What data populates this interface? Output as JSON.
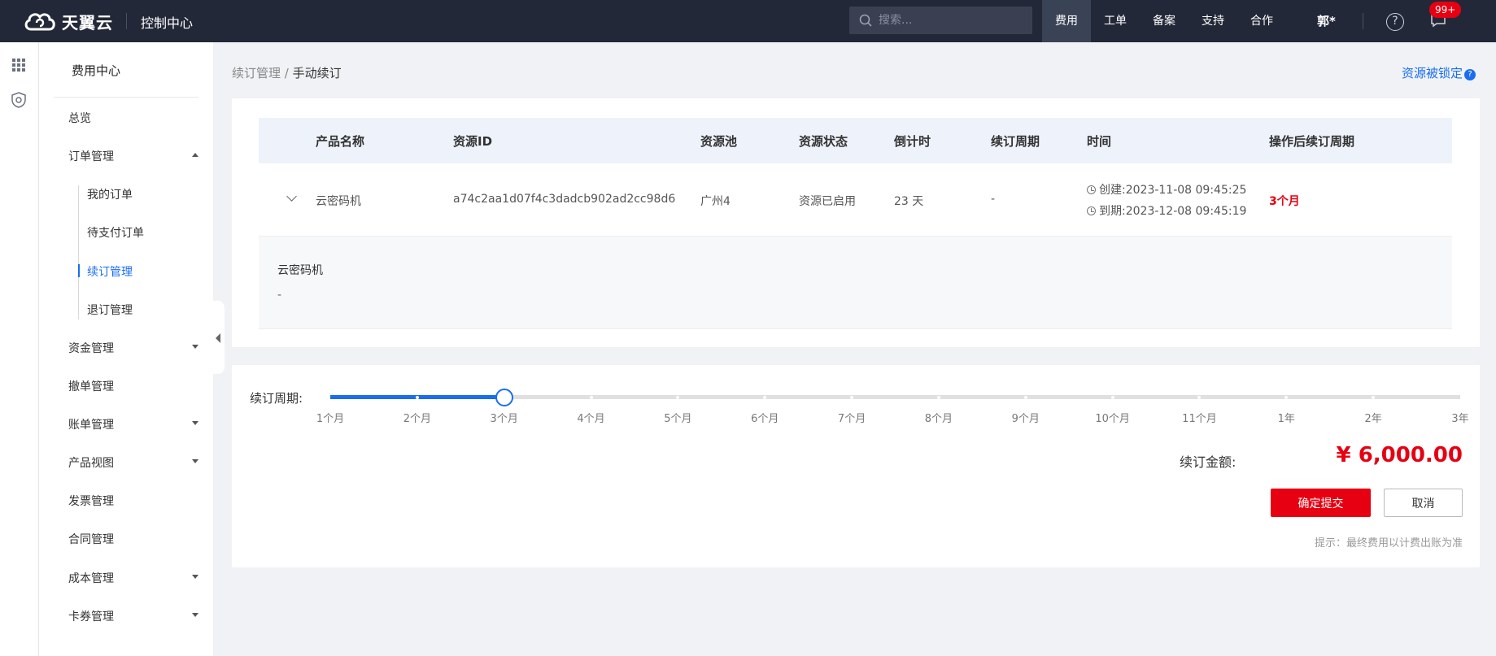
{
  "topbar": {
    "logo_text": "天翼云",
    "console_title": "控制中心",
    "search_placeholder": "搜索...",
    "nav": [
      "费用",
      "工单",
      "备案",
      "支持",
      "合作"
    ],
    "user": "郭*",
    "badge": "99+"
  },
  "sidebar": {
    "title": "费用中心",
    "items": {
      "overview": "总览",
      "orders": "订单管理",
      "my_orders": "我的订单",
      "pending_orders": "待支付订单",
      "renewal": "续订管理",
      "unsubscribe": "退订管理",
      "funds": "资金管理",
      "withdraw": "撤单管理",
      "bills": "账单管理",
      "product_view": "产品视图",
      "invoice": "发票管理",
      "contract": "合同管理",
      "cost": "成本管理",
      "coupons": "卡券管理"
    }
  },
  "breadcrumb": {
    "parent": "续订管理",
    "sep": "/",
    "current": "手动续订"
  },
  "lock_link": "资源被锁定",
  "table": {
    "headers": {
      "name": "产品名称",
      "id": "资源ID",
      "pool": "资源池",
      "status": "资源状态",
      "countdown": "倒计时",
      "period": "续订周期",
      "time": "时间",
      "after": "操作后续订周期"
    },
    "row": {
      "name": "云密码机",
      "id": "a74c2aa1d07f4c3dadcb902ad2cc98d6",
      "pool": "广州4",
      "status": "资源已启用",
      "countdown": "23 天",
      "period": "-",
      "created": "创建:2023-11-08 09:45:25",
      "expires": "到期:2023-12-08 09:45:19",
      "after": "3个月"
    },
    "detail": {
      "name": "云密码机",
      "value": "-"
    }
  },
  "renewal": {
    "label": "续订周期:",
    "options": [
      "1个月",
      "2个月",
      "3个月",
      "4个月",
      "5个月",
      "6个月",
      "7个月",
      "8个月",
      "9个月",
      "10个月",
      "11个月",
      "1年",
      "2年",
      "3年"
    ],
    "selected_index": 2,
    "amount_label": "续订金额:",
    "amount": "¥ 6,000.00",
    "confirm": "确定提交",
    "cancel": "取消",
    "hint": "提示：最终费用以计费出账为准"
  },
  "colors": {
    "primary": "#1a6df0",
    "danger": "#e60012",
    "topbar": "#232838"
  }
}
